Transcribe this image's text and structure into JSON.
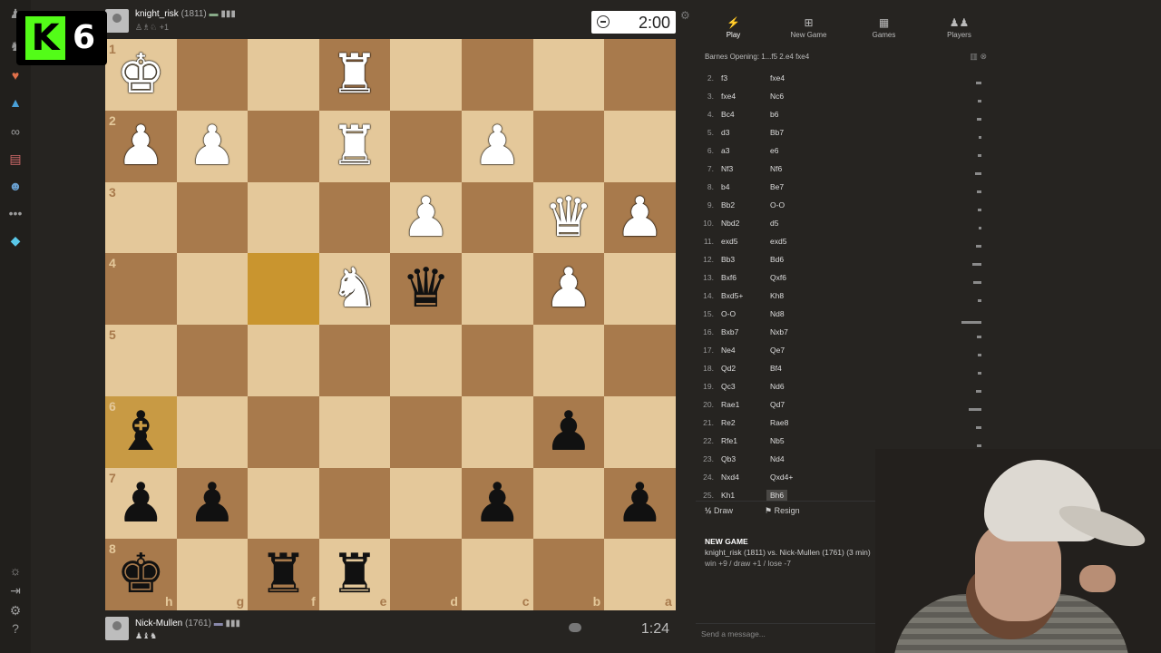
{
  "overlay": {
    "logo_letter": "K",
    "logo_number": "6"
  },
  "top_player": {
    "name": "knight_risk",
    "rating": "(1811)",
    "sub": "+1"
  },
  "bottom_player": {
    "name": "Nick-Mullen",
    "rating": "(1761)"
  },
  "clocks": {
    "top": "2:00",
    "bottom": "1:24"
  },
  "board": {
    "rank_labels": [
      "1",
      "2",
      "3",
      "4",
      "5",
      "6",
      "7",
      "8"
    ],
    "file_labels": [
      "h",
      "g",
      "f",
      "e",
      "d",
      "c",
      "b",
      "a"
    ],
    "squares": [
      [
        "K",
        "",
        "",
        "R",
        "",
        "",
        "",
        ""
      ],
      [
        "P",
        "P",
        "",
        "R",
        "",
        "P",
        "",
        ""
      ],
      [
        "",
        "",
        "",
        "",
        "P",
        "",
        "Q",
        "P"
      ],
      [
        "",
        "",
        "",
        "N",
        "q",
        "",
        "P",
        ""
      ],
      [
        "",
        "",
        "",
        "",
        "",
        "",
        "",
        ""
      ],
      [
        "b",
        "",
        "",
        "",
        "",
        "",
        "p",
        ""
      ],
      [
        "p",
        "p",
        "",
        "",
        "",
        "p",
        "",
        "p"
      ],
      [
        "k",
        "",
        "r",
        "r",
        "",
        "",
        "",
        ""
      ]
    ]
  },
  "tabs": [
    {
      "label": "Play",
      "icon": "bolt-icon"
    },
    {
      "label": "New Game",
      "icon": "plus-icon"
    },
    {
      "label": "Games",
      "icon": "board-icon"
    },
    {
      "label": "Players",
      "icon": "players-icon"
    }
  ],
  "opening": "Barnes Opening: 1...f5 2.e4 fxe4",
  "moves": [
    {
      "no": "2.",
      "w": "f3",
      "b": "fxe4"
    },
    {
      "no": "3.",
      "w": "fxe4",
      "b": "Nc6"
    },
    {
      "no": "4.",
      "w": "Bc4",
      "b": "b6"
    },
    {
      "no": "5.",
      "w": "d3",
      "b": "Bb7"
    },
    {
      "no": "6.",
      "w": "a3",
      "b": "e6"
    },
    {
      "no": "7.",
      "w": "Nf3",
      "b": "Nf6"
    },
    {
      "no": "8.",
      "w": "b4",
      "b": "Be7"
    },
    {
      "no": "9.",
      "w": "Bb2",
      "b": "O-O"
    },
    {
      "no": "10.",
      "w": "Nbd2",
      "b": "d5"
    },
    {
      "no": "11.",
      "w": "exd5",
      "b": "exd5"
    },
    {
      "no": "12.",
      "w": "Bb3",
      "b": "Bd6"
    },
    {
      "no": "13.",
      "w": "Bxf6",
      "b": "Qxf6"
    },
    {
      "no": "14.",
      "w": "Bxd5+",
      "b": "Kh8"
    },
    {
      "no": "15.",
      "w": "O-O",
      "b": "Nd8"
    },
    {
      "no": "16.",
      "w": "Bxb7",
      "b": "Nxb7"
    },
    {
      "no": "17.",
      "w": "Ne4",
      "b": "Qe7"
    },
    {
      "no": "18.",
      "w": "Qd2",
      "b": "Bf4"
    },
    {
      "no": "19.",
      "w": "Qc3",
      "b": "Nd6"
    },
    {
      "no": "20.",
      "w": "Rae1",
      "b": "Qd7"
    },
    {
      "no": "21.",
      "w": "Re2",
      "b": "Rae8"
    },
    {
      "no": "22.",
      "w": "Rfe1",
      "b": "Nb5"
    },
    {
      "no": "23.",
      "w": "Qb3",
      "b": "Nd4"
    },
    {
      "no": "24.",
      "w": "Nxd4",
      "b": "Qxd4+"
    },
    {
      "no": "25.",
      "w": "Kh1",
      "b": "Bh6"
    }
  ],
  "actions": {
    "draw_glyph": "½",
    "draw": "Draw",
    "resign": "Resign"
  },
  "new_game": {
    "title": "NEW GAME",
    "line1": "knight_risk (1811) vs. Nick-Mullen (1761) (3 min)",
    "line2": "win +9 / draw +1 / lose -7"
  },
  "message_placeholder": "Send a message..."
}
